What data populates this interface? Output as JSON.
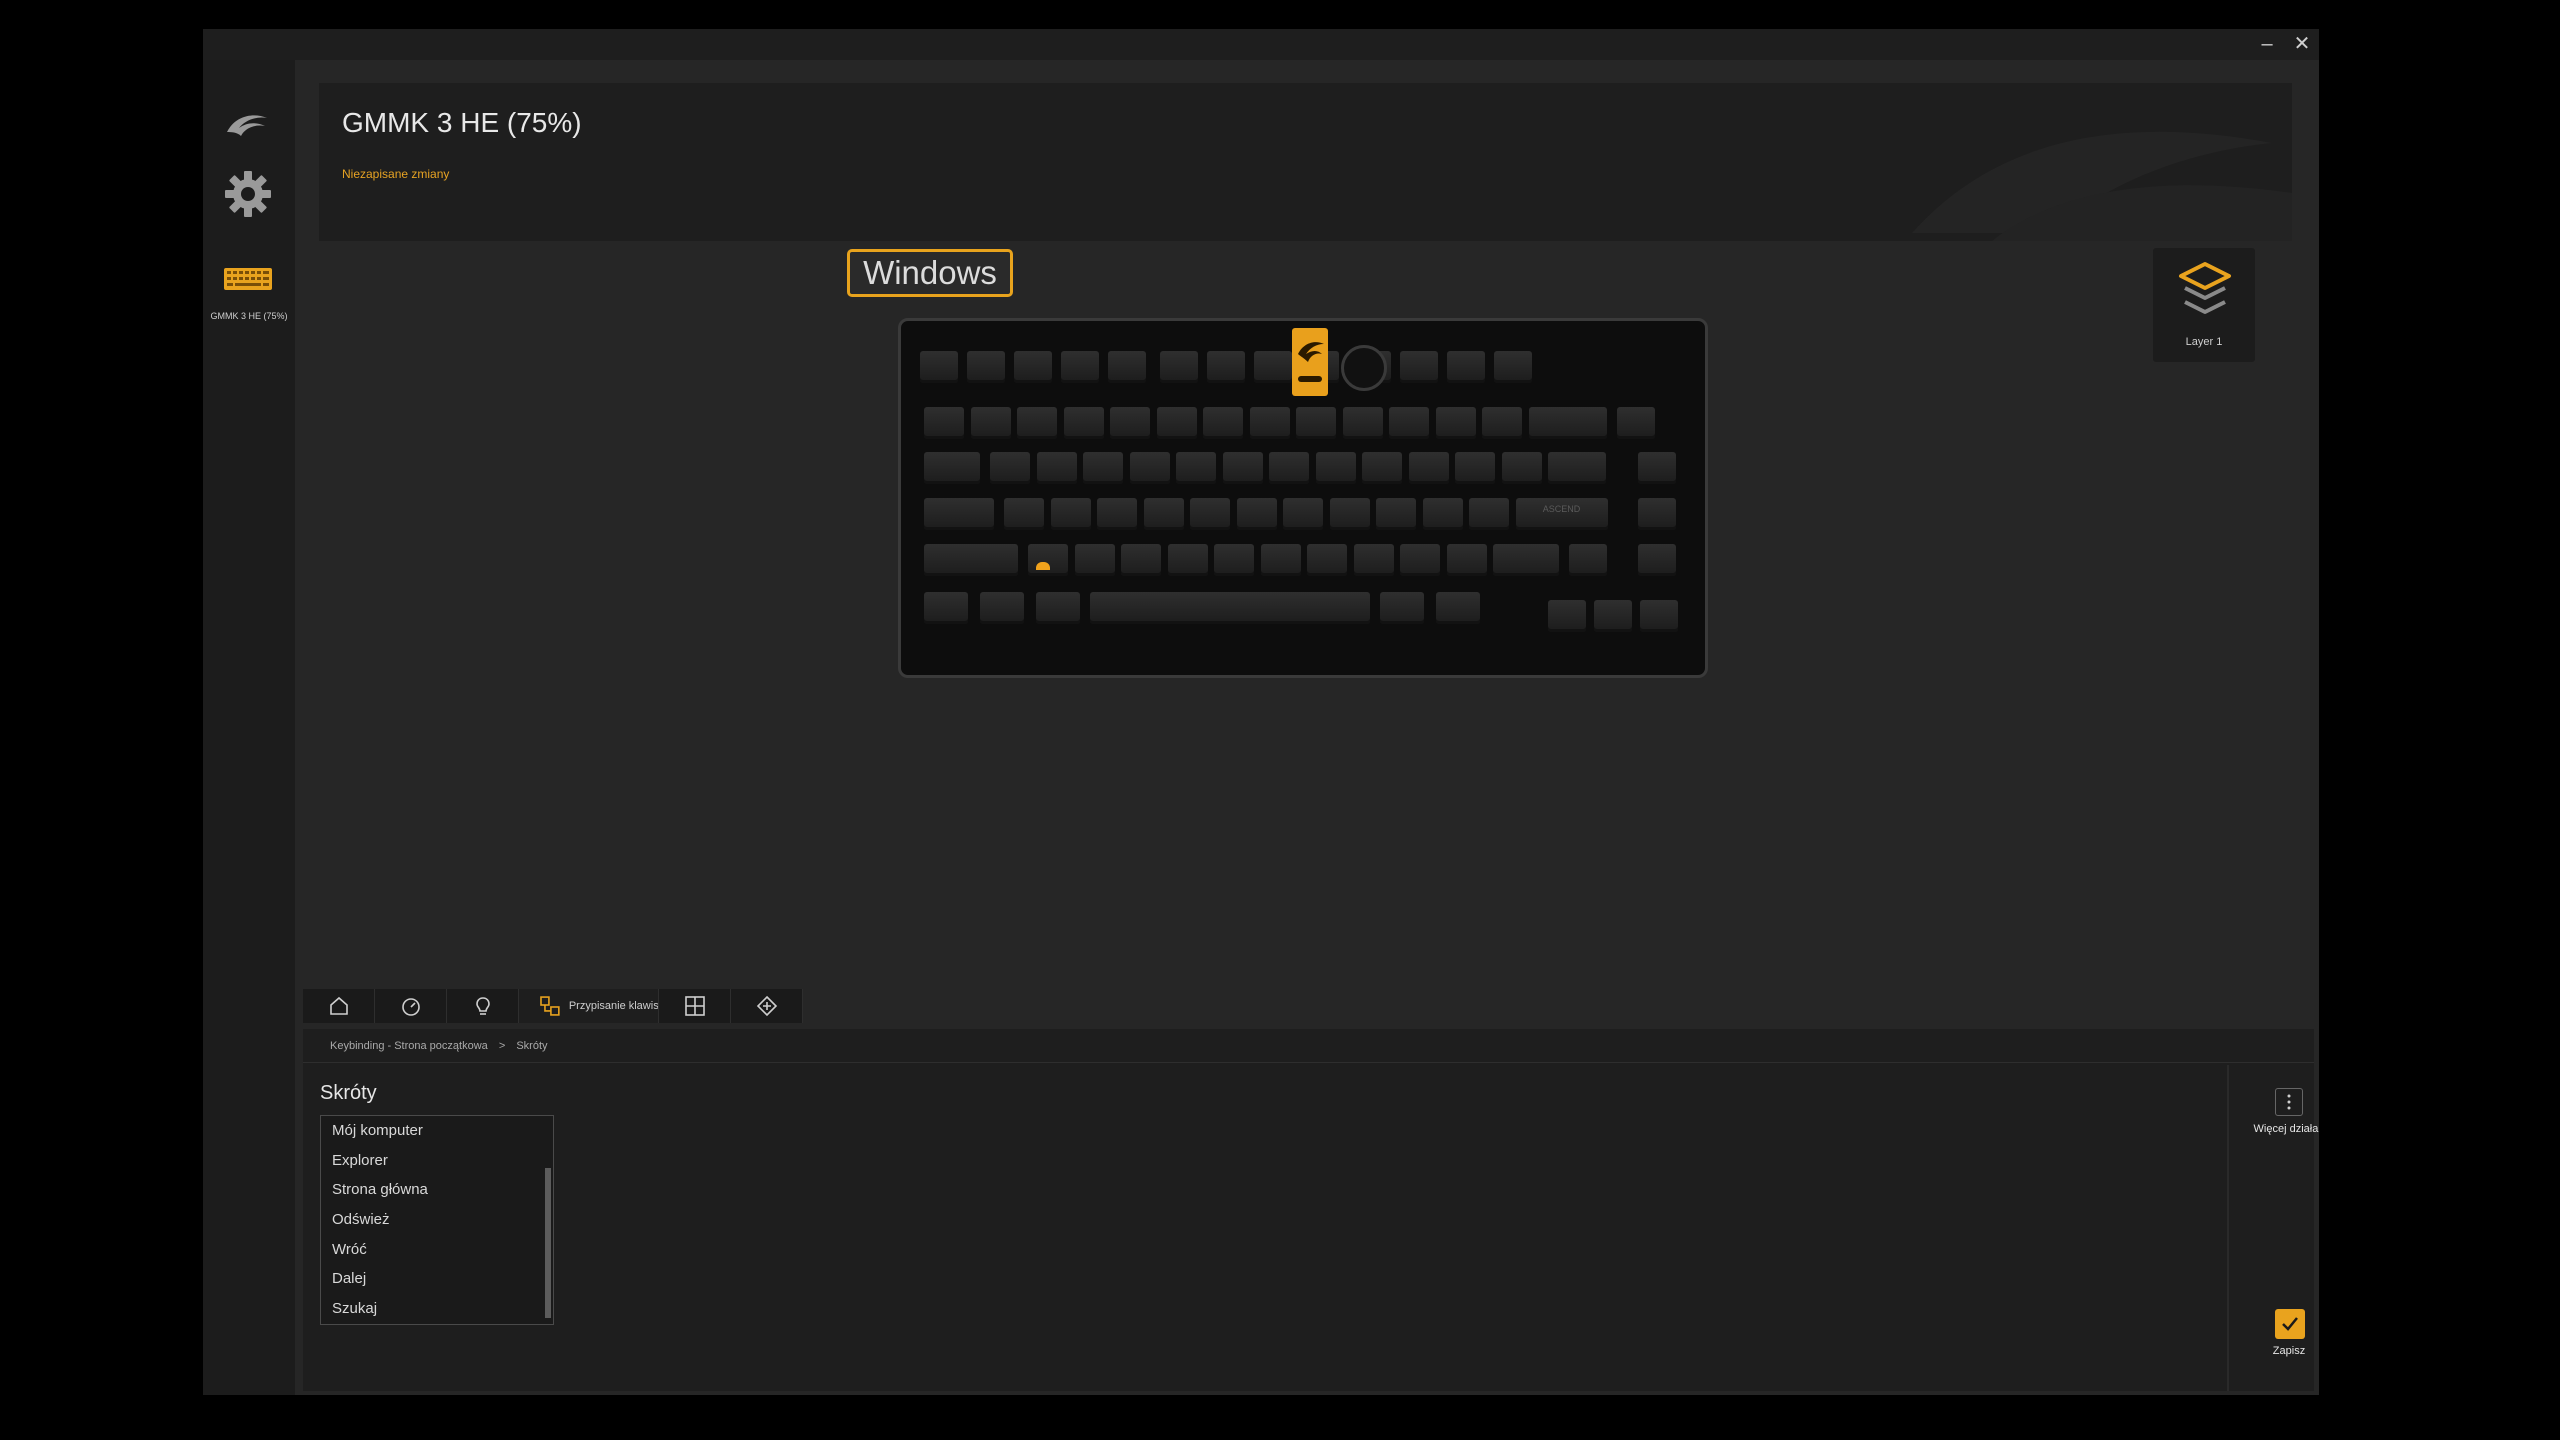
{
  "window": {
    "minimize_glyph": "–",
    "close_glyph": "✕"
  },
  "sidebar": {
    "device_label": "GMMK 3 HE (75%)"
  },
  "header": {
    "title": "GMMK 3 HE (75%)",
    "status": "Niezapisane zmiany"
  },
  "os_badge": "Windows",
  "layer": {
    "label": "Layer 1"
  },
  "keyboard": {
    "row_enter_label": "ASCEND"
  },
  "tabs": {
    "active_label": "Przypisanie klawis"
  },
  "breadcrumb": {
    "part1": "Keybinding - Strona początkowa",
    "separator": ">",
    "part2": "Skróty"
  },
  "section": {
    "title": "Skróty"
  },
  "shortcuts": [
    "Mój komputer",
    "Explorer",
    "Strona główna",
    "Odśwież",
    "Wróć",
    "Dalej",
    "Szukaj"
  ],
  "actions": {
    "more_label": "Więcej działań",
    "save_label": "Zapisz"
  },
  "colors": {
    "accent": "#e9a31e",
    "background": "#262626",
    "panel": "#1e1e1e"
  }
}
